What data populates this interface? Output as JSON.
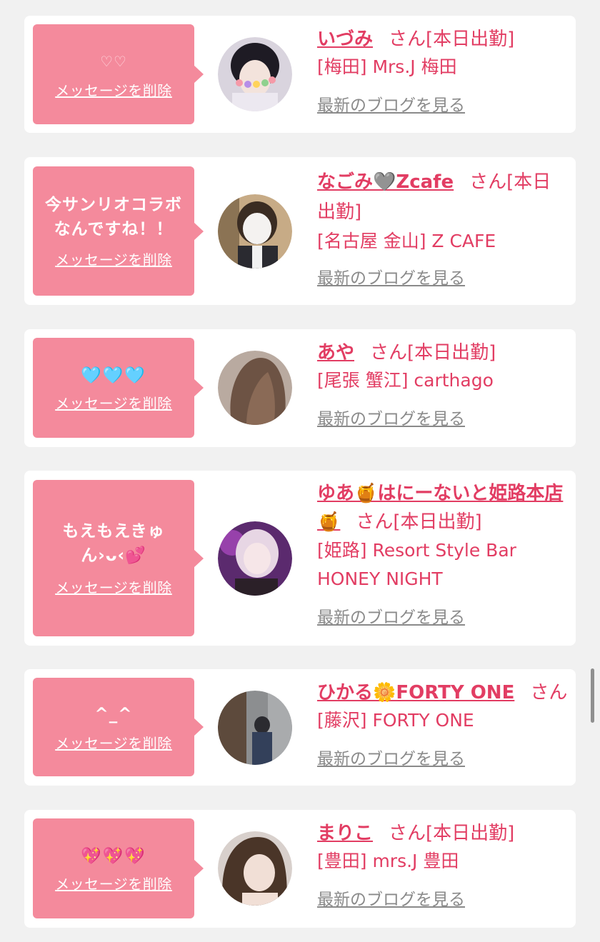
{
  "delete_label": "メッセージを削除",
  "blog_label": "最新のブログを見る",
  "san_label": "さん",
  "cards": [
    {
      "message": "♡♡",
      "name": "いづみ",
      "status": "[本日出勤]",
      "shop": "[梅田] Mrs.J 梅田"
    },
    {
      "message": "今サンリオコラボなんですね！！",
      "name": "なごみ🩶Zcafe",
      "status": "[本日出勤]",
      "shop": "[名古屋 金山] Z CAFE"
    },
    {
      "message": "🩵🩵🩵",
      "name": "あや",
      "status": "[本日出勤]",
      "shop": "[尾張 蟹江] carthago"
    },
    {
      "message": "もえもえきゅん›ᴗ‹💕",
      "name": "ゆあ🍯はにーないと姫路本店🍯",
      "status": "[本日出勤]",
      "shop": "[姫路] Resort Style Bar HONEY NIGHT"
    },
    {
      "message": "^_^",
      "name": "ひかる🌼FORTY ONE",
      "status": "",
      "shop": "[藤沢] FORTY ONE"
    },
    {
      "message": "💖💖💖",
      "name": "まりこ",
      "status": "[本日出勤]",
      "shop": "[豊田] mrs.J 豊田"
    }
  ],
  "colors": {
    "accent": "#e23d63",
    "bubble": "#f48a9c",
    "background": "#f1f1f1",
    "link_gray": "#8a8a8a"
  }
}
